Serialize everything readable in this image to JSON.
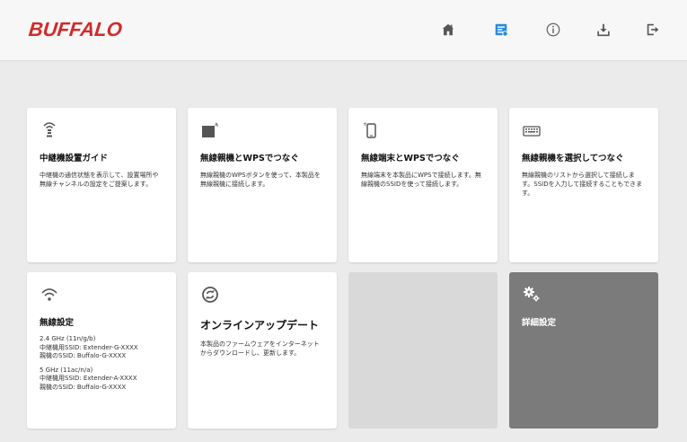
{
  "header": {
    "brand": "BUFFALO",
    "accent_color": "#d22a2a",
    "nav": [
      {
        "name": "home-icon"
      },
      {
        "name": "settings-panel-icon",
        "active_color": "#2a8ad8"
      },
      {
        "name": "info-icon"
      },
      {
        "name": "download-icon"
      },
      {
        "name": "logout-icon"
      }
    ]
  },
  "cards": [
    {
      "icon": "signal-icon",
      "title": "中継機設置ガイド",
      "desc": "中継機の通信状態を表示して、設置場所や無線チャンネルの設定をご提案します。"
    },
    {
      "icon": "wps-device-icon",
      "title": "無線親機とWPSでつなぐ",
      "desc": "無線親機のWPSボタンを使って、本製品を無線親機に接続します。"
    },
    {
      "icon": "smartphone-icon",
      "title": "無線端末とWPSでつなぐ",
      "desc": "無線端末を本製品にWPSで接続します。無線親機のSSIDを使って接続します。"
    },
    {
      "icon": "keyboard-icon",
      "title": "無線親機を選択してつなぐ",
      "desc": "無線親機のリストから選択して接続します。SSIDを入力して接続することもできます。"
    },
    {
      "icon": "wifi-icon",
      "title": "無線設定",
      "band1": "2.4 GHz (11n/g/b)",
      "band1_ssid_ext": "中継機用SSID: Extender-G-XXXX",
      "band1_ssid_parent": "親機のSSID: Buffalo-G-XXXX",
      "band2": "5 GHz (11ac/n/a)",
      "band2_ssid_ext": "中継機用SSID: Extender-A-XXXX",
      "band2_ssid_parent": "親機のSSID: Buffalo-G-XXXX"
    },
    {
      "icon": "update-icon",
      "title": "オンラインアップデート",
      "desc": "本製品のファームウェアをインターネットからダウンロードし、更新します。"
    },
    {
      "title": "詳細設定",
      "icon": "gears-icon"
    }
  ]
}
